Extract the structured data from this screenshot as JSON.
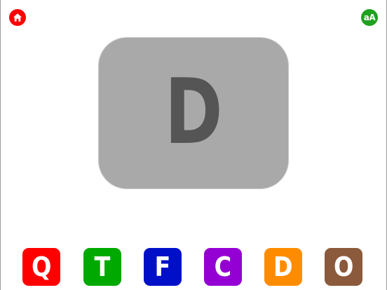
{
  "header": {
    "home_icon": "home-icon",
    "case_toggle_label": "aA"
  },
  "card": {
    "letter": "D",
    "background": "#a9a9a9",
    "letter_color": "#555555"
  },
  "choices": [
    {
      "letter": "Q",
      "color": "#ff0000"
    },
    {
      "letter": "T",
      "color": "#00a900"
    },
    {
      "letter": "F",
      "color": "#0010c8"
    },
    {
      "letter": "C",
      "color": "#9400d3"
    },
    {
      "letter": "D",
      "color": "#ff8c00"
    },
    {
      "letter": "O",
      "color": "#8b5a3c"
    }
  ],
  "colors": {
    "home_button": "#ff0000",
    "case_button": "#1fa21f"
  }
}
